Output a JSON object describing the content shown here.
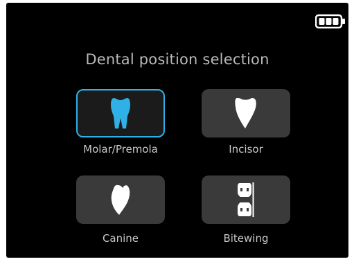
{
  "status_bar": {
    "battery_icon": "battery-icon",
    "battery_level": 1.0
  },
  "page": {
    "title": "Dental position selection"
  },
  "options": [
    {
      "label": "Molar/Premola",
      "icon": "molar-tooth-icon",
      "selected": true
    },
    {
      "label": "Incisor",
      "icon": "incisor-tooth-icon",
      "selected": false
    },
    {
      "label": "Canine",
      "icon": "canine-tooth-icon",
      "selected": false
    },
    {
      "label": "Bitewing",
      "icon": "bitewing-icon",
      "selected": false
    }
  ],
  "colors": {
    "background": "#000000",
    "tile": "#3a3a3a",
    "tile_selected": "#1b1b1b",
    "accent": "#2fb0e6",
    "text": "#c9c9c9"
  }
}
